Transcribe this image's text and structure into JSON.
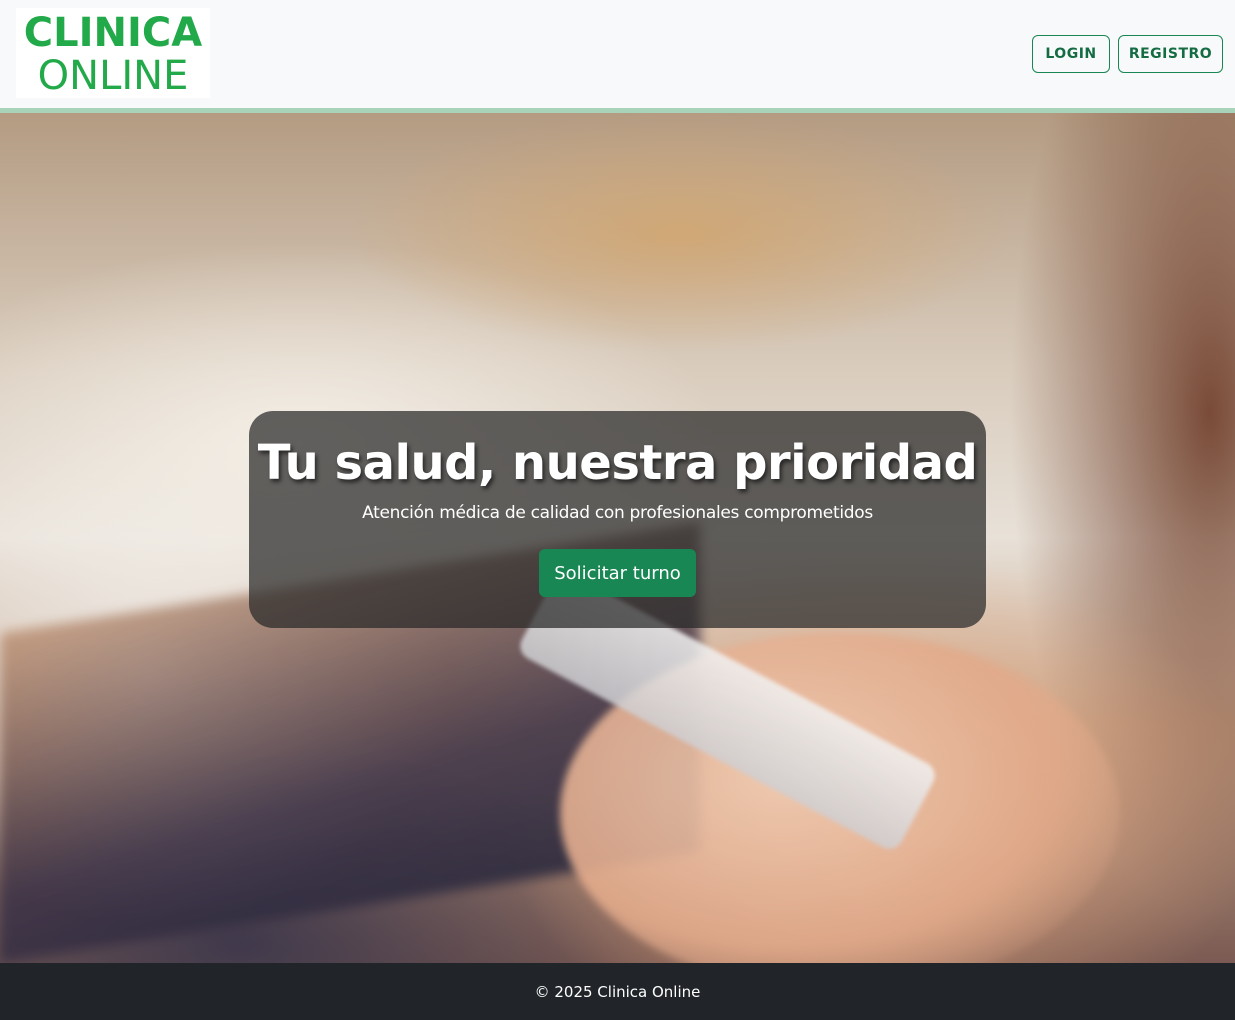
{
  "navbar": {
    "logo": {
      "line1": "CLINICA",
      "line2": "ONLINE"
    },
    "login_label": "LOGIN",
    "register_label": "REGISTRO"
  },
  "hero": {
    "title": "Tu salud, nuestra prioridad",
    "subtitle": "Atención médica de calidad con profesionales comprometidos",
    "cta_label": "Solicitar turno"
  },
  "footer": {
    "text": "© 2025 Clinica Online"
  },
  "colors": {
    "brand_green": "#22a949",
    "button_green": "#198754",
    "footer_bg": "#212529",
    "navbar_bg": "#f8f9fa"
  }
}
